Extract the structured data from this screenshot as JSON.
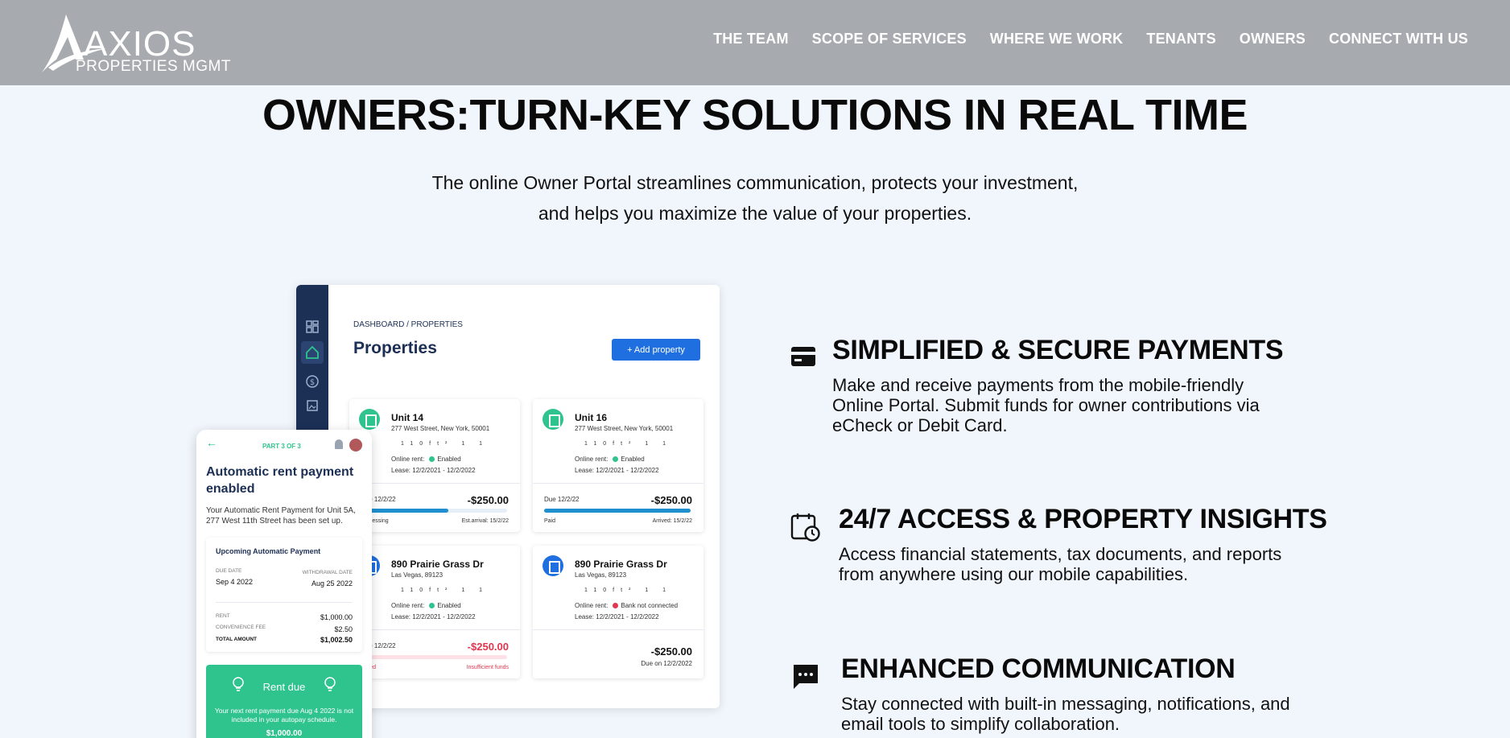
{
  "header": {
    "logo_word": "AXIOS",
    "logo_sub": "PROPERTIES MGMT",
    "nav": [
      "THE TEAM",
      "SCOPE OF SERVICES",
      "WHERE WE WORK",
      "TENANTS",
      "OWNERS",
      "CONNECT WITH US"
    ]
  },
  "hero": {
    "title": "OWNERS:TURN-KEY SOLUTIONS IN REAL TIME",
    "subtitle_line1": "The online Owner Portal streamlines communication, protects your investment,",
    "subtitle_line2": "and helps you maximize the value of your properties."
  },
  "dashboard": {
    "breadcrumb": "DASHBOARD / PROPERTIES",
    "title": "Properties",
    "add_button": "+ Add property",
    "cards": [
      {
        "name": "Unit 14",
        "address": "277 West Street, New York, 50001",
        "meta": "110ft² 1 1",
        "online_rent_label": "Online rent:",
        "online_rent_status": "Enabled",
        "lease_label": "Lease:",
        "lease": "12/2/2021 - 12/2/2022",
        "due": "Due 12/2/22",
        "amount": "-$250.00",
        "status_left": "Processing",
        "status_right": "Est.arrival: 15/2/22",
        "progress": 0.6
      },
      {
        "name": "Unit 16",
        "address": "277 West Street, New York, 50001",
        "meta": "110ft² 1 1",
        "online_rent_label": "Online rent:",
        "online_rent_status": "Enabled",
        "lease_label": "Lease:",
        "lease": "12/2/2021 - 12/2/2022",
        "due": "Due 12/2/22",
        "amount": "-$250.00",
        "status_left": "Paid",
        "status_right": "Arrived: 15/2/22",
        "progress": 1.0
      },
      {
        "name": "890 Prairie Grass Dr",
        "address": "Las Vegas, 89123",
        "meta": "110ft² 1 1",
        "online_rent_label": "Online rent:",
        "online_rent_status": "Enabled",
        "lease_label": "Lease:",
        "lease": "12/2/2021 - 12/2/2022",
        "due": "Due 12/2/22",
        "amount": "-$250.00",
        "status_left": "Failed",
        "status_right": "Insufficient funds",
        "progress": 0.05
      },
      {
        "name": "890 Prairie Grass Dr",
        "address": "Las Vegas, 89123",
        "meta": "110ft² 1 1",
        "online_rent_label": "Online rent:",
        "online_rent_status": "Bank not connected",
        "lease_label": "Lease:",
        "lease": "12/2/2021 - 12/2/2022",
        "amount": "-$250.00",
        "due_right": "Due on 12/2/2022"
      }
    ],
    "colors": {
      "sidebar": "#1c2f55",
      "accent_green": "#2fc48d",
      "accent_blue": "#1f6fe0",
      "alert_red": "#e0364f"
    }
  },
  "phone": {
    "step": "PART 3 OF 3",
    "title": "Automatic rent payment enabled",
    "desc": "Your Automatic Rent Payment for Unit 5A, 277 West 11th Street has been set up.",
    "box_title": "Upcoming Automatic Payment",
    "due_label": "DUE DATE",
    "due_value": "Sep 4 2022",
    "withdrawal_label": "WITHDRAWAL DATE",
    "withdrawal_value": "Aug 25 2022",
    "rent_label": "RENT",
    "rent_value": "$1,000.00",
    "fee_label": "CONVENIENCE FEE",
    "fee_value": "$2.50",
    "total_label": "TOTAL AMOUNT",
    "total_value": "$1,002.50",
    "rent_due_title": "Rent due",
    "rent_due_desc": "Your next rent payment due Aug 4 2022 is not included in your autopay schedule.",
    "rent_due_amount": "$1,000.00"
  },
  "features": [
    {
      "icon": "credit-card-icon",
      "title": "SIMPLIFIED & SECURE PAYMENTS",
      "body": "Make and receive payments from the mobile-friendly Online Portal. Submit funds for owner contributions via eCheck or Debit Card."
    },
    {
      "icon": "calendar-clock-icon",
      "title": "24/7 ACCESS & PROPERTY INSIGHTS",
      "body": "Access financial statements, tax documents, and reports from anywhere using our mobile capabilities."
    },
    {
      "icon": "chat-icon",
      "title": "ENHANCED COMMUNICATION",
      "body": "Stay connected with built-in messaging, notifications, and email tools to simplify collaboration."
    }
  ]
}
